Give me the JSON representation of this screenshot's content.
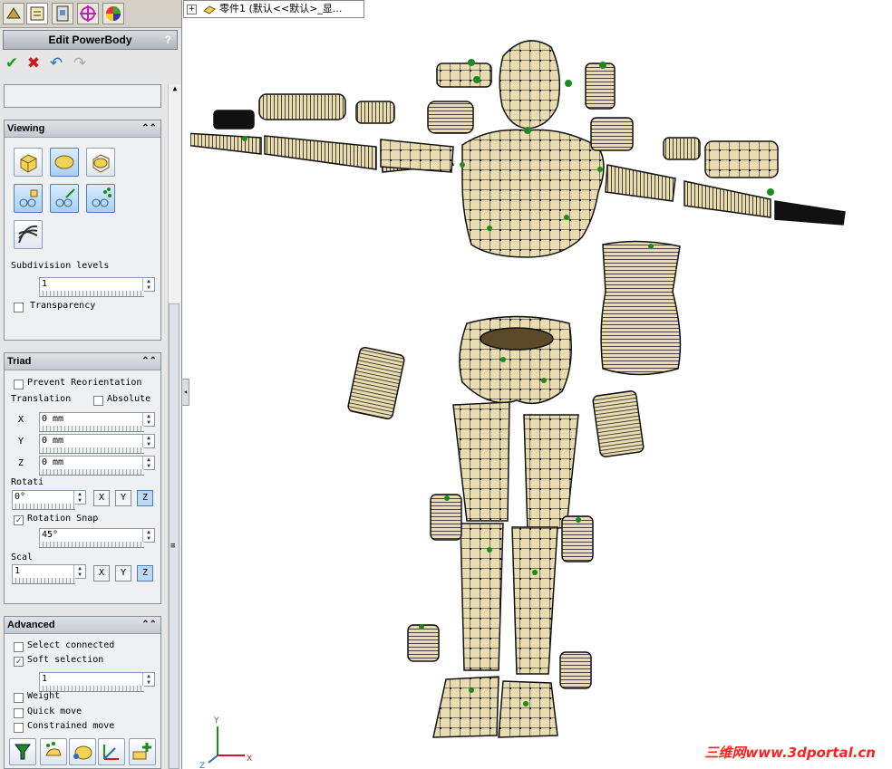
{
  "feature_manager": {
    "tree_item": "零件1 (默认<<默认>_显..."
  },
  "property_manager": {
    "title": "Edit PowerBody",
    "help": "?"
  },
  "viewing": {
    "title": "Viewing",
    "subdivision_label": "Subdivision levels",
    "subdivision_value": "1",
    "transparency_label": "Transparency"
  },
  "triad": {
    "title": "Triad",
    "prevent_reorientation_label": "Prevent Reorientation",
    "translation_label": "Translation",
    "absolute_label": "Absolute",
    "x_label": "X",
    "x_value": "0 mm",
    "y_label": "Y",
    "y_value": "0 mm",
    "z_label": "Z",
    "z_value": "0 mm",
    "rotation_label": "Rotati",
    "rotation_value": "0°",
    "rotation_snap_label": "Rotation Snap",
    "rotation_snap_value": "45°",
    "scale_label": "Scal",
    "scale_value": "1",
    "axis_x": "X",
    "axis_y": "Y",
    "axis_z": "Z"
  },
  "advanced": {
    "title": "Advanced",
    "select_connected_label": "Select connected",
    "soft_selection_label": "Soft selection",
    "soft_selection_value": "1",
    "weight_label": "Weight",
    "quick_move_label": "Quick move",
    "constrained_move_label": "Constrained move"
  },
  "triad_axes": {
    "x": "X",
    "y": "Y",
    "z": "Z"
  },
  "watermark": "三维网www.3dportal.cn",
  "colors": {
    "body_fill": "#e8dcb0",
    "mesh_line": "#111111",
    "vertex": "#1d8a1d",
    "accent": "#ff2020"
  }
}
